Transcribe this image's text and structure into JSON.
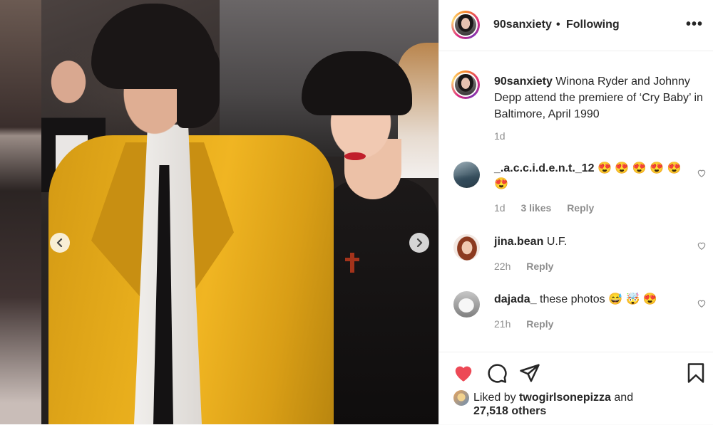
{
  "header": {
    "username": "90sanxiety",
    "separator": "•",
    "follow_status": "Following",
    "more_label": "•••"
  },
  "caption": {
    "username": "90sanxiety",
    "text": "Winona Ryder and Johnny Depp attend the premiere of ‘Cry Baby’ in Baltimore, April 1990",
    "time": "1d"
  },
  "comments": [
    {
      "username": "_.a.c.c.i.d.e.n.t._12",
      "text": "😍 😍 😍 😍 😍 😍",
      "time": "1d",
      "likes": "3 likes",
      "reply": "Reply"
    },
    {
      "username": "jina.bean",
      "text": "U.F.",
      "time": "22h",
      "reply": "Reply"
    },
    {
      "username": "dajada_",
      "text": "these photos 😅 🤯 😍",
      "time": "21h",
      "reply": "Reply"
    }
  ],
  "likes": {
    "prefix": "Liked by",
    "user": "twogirlsonepizza",
    "suffix": "and",
    "count": "27,518 others"
  },
  "colors": {
    "liked_heart": "#ed4956",
    "meta_gray": "#8e8e8e",
    "text": "#262626"
  },
  "icons": {
    "prev": "chevron-left-icon",
    "next": "chevron-right-icon",
    "like": "heart-filled-icon",
    "comment": "comment-bubble-icon",
    "share": "paper-plane-icon",
    "save": "bookmark-icon"
  }
}
